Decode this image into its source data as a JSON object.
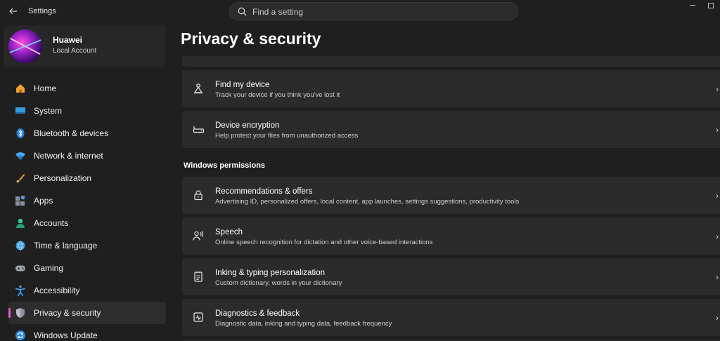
{
  "window": {
    "title": "Settings"
  },
  "search": {
    "placeholder": "Find a setting"
  },
  "profile": {
    "name": "Huawei",
    "account_type": "Local Account"
  },
  "sidebar": {
    "items": [
      {
        "label": "Home",
        "icon": "home-icon"
      },
      {
        "label": "System",
        "icon": "system-icon"
      },
      {
        "label": "Bluetooth & devices",
        "icon": "bluetooth-icon"
      },
      {
        "label": "Network & internet",
        "icon": "wifi-icon"
      },
      {
        "label": "Personalization",
        "icon": "brush-icon"
      },
      {
        "label": "Apps",
        "icon": "apps-icon"
      },
      {
        "label": "Accounts",
        "icon": "accounts-icon"
      },
      {
        "label": "Time & language",
        "icon": "globe-icon"
      },
      {
        "label": "Gaming",
        "icon": "gamepad-icon"
      },
      {
        "label": "Accessibility",
        "icon": "accessibility-icon"
      },
      {
        "label": "Privacy & security",
        "icon": "shield-icon",
        "active": true
      },
      {
        "label": "Windows Update",
        "icon": "update-icon"
      }
    ]
  },
  "main": {
    "page_title": "Privacy & security",
    "cards": [
      {
        "title": "Find my device",
        "subtitle": "Track your device if you think you've lost it",
        "icon": "find-device-icon"
      },
      {
        "title": "Device encryption",
        "subtitle": "Help protect your files from unauthorized access",
        "icon": "encryption-icon"
      }
    ],
    "section_title": "Windows permissions",
    "permissions": [
      {
        "title": "Recommendations & offers",
        "subtitle": "Advertising ID, personalized offers, local content, app launches, settings suggestions, productivity tools",
        "icon": "lock-icon"
      },
      {
        "title": "Speech",
        "subtitle": "Online speech recognition for dictation and other voice-based interactions",
        "icon": "speech-icon"
      },
      {
        "title": "Inking & typing personalization",
        "subtitle": "Custom dictionary, words in your dictionary",
        "icon": "inking-icon"
      },
      {
        "title": "Diagnostics & feedback",
        "subtitle": "Diagnostic data, inking and typing data, feedback frequency",
        "icon": "diagnostics-icon"
      }
    ]
  },
  "colors": {
    "accent": "#e05ac8",
    "background": "#1f1f1f",
    "card": "#2b2b2b"
  }
}
